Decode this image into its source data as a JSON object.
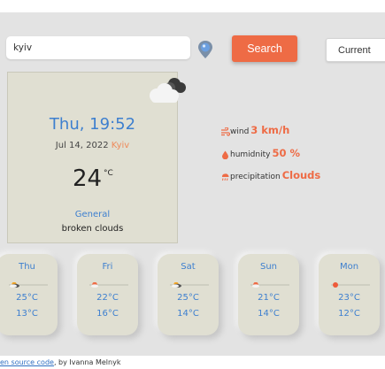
{
  "search": {
    "value": "kyiv",
    "button_label": "Search"
  },
  "current_button_label": "Current",
  "today": {
    "day_time": "Thu, 19:52",
    "date": "Jul 14, 2022",
    "city": "Kyiv",
    "temperature": "24",
    "unit": "°C",
    "group": "General",
    "description": "broken clouds"
  },
  "details": {
    "wind_label": "wind",
    "wind_value": "3 km/h",
    "humidity_label": "humidnity",
    "humidity_value": "50 %",
    "precipitation_label": "precipitation",
    "precipitation_value": "Clouds"
  },
  "forecast": [
    {
      "day": "Thu",
      "max": "25°C",
      "min": "13°C",
      "icon": "sun-behind-cloud-icon"
    },
    {
      "day": "Fri",
      "max": "22°C",
      "min": "16°C",
      "icon": "sun-behind-cloud-icon"
    },
    {
      "day": "Sat",
      "max": "25°C",
      "min": "14°C",
      "icon": "sun-behind-cloud-icon"
    },
    {
      "day": "Sun",
      "max": "21°C",
      "min": "14°C",
      "icon": "sun-behind-cloud-icon"
    },
    {
      "day": "Mon",
      "max": "23°C",
      "min": "12°C",
      "icon": "sun-icon"
    }
  ],
  "footer": {
    "link_text": "en source code",
    "credit": ", by Ivanna Melnyk"
  },
  "colors": {
    "accent": "#ee6b45",
    "blue": "#3d7fcf",
    "card": "#e0dfd2",
    "background": "#e3e3e3"
  }
}
